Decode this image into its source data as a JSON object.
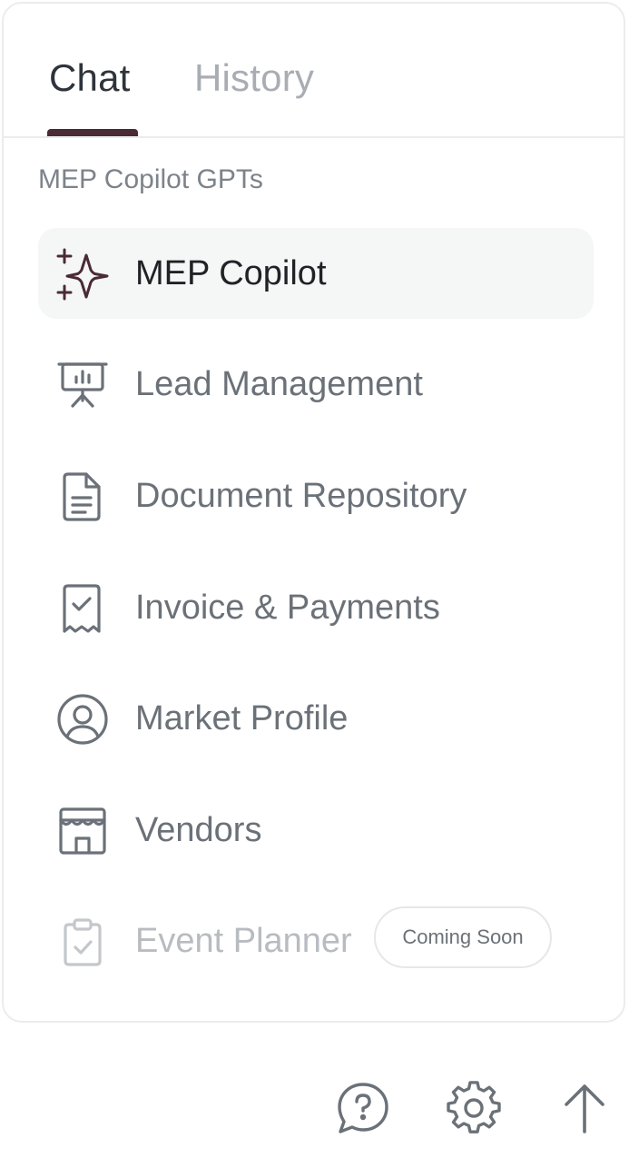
{
  "tabs": {
    "chat": "Chat",
    "history": "History"
  },
  "section_title": "MEP Copilot GPTs",
  "items": [
    {
      "label": "MEP Copilot",
      "icon": "sparkles-icon",
      "active": true
    },
    {
      "label": "Lead Management",
      "icon": "presentation-chart-icon"
    },
    {
      "label": "Document Repository",
      "icon": "document-icon"
    },
    {
      "label": "Invoice & Payments",
      "icon": "receipt-check-icon"
    },
    {
      "label": "Market Profile",
      "icon": "user-circle-icon"
    },
    {
      "label": "Vendors",
      "icon": "storefront-icon"
    },
    {
      "label": "Event Planner",
      "icon": "clipboard-check-icon",
      "disabled": true,
      "badge": "Coming Soon"
    }
  ],
  "footer": {
    "icons": [
      "help-chat-icon",
      "gear-icon",
      "arrow-up-icon"
    ]
  },
  "colors": {
    "accent": "#4a2a35",
    "active_bg": "#f5f6f6",
    "text_primary": "#1f2226",
    "text_secondary": "#6b7178",
    "text_disabled": "#b8bcc0",
    "border": "#ececec"
  }
}
